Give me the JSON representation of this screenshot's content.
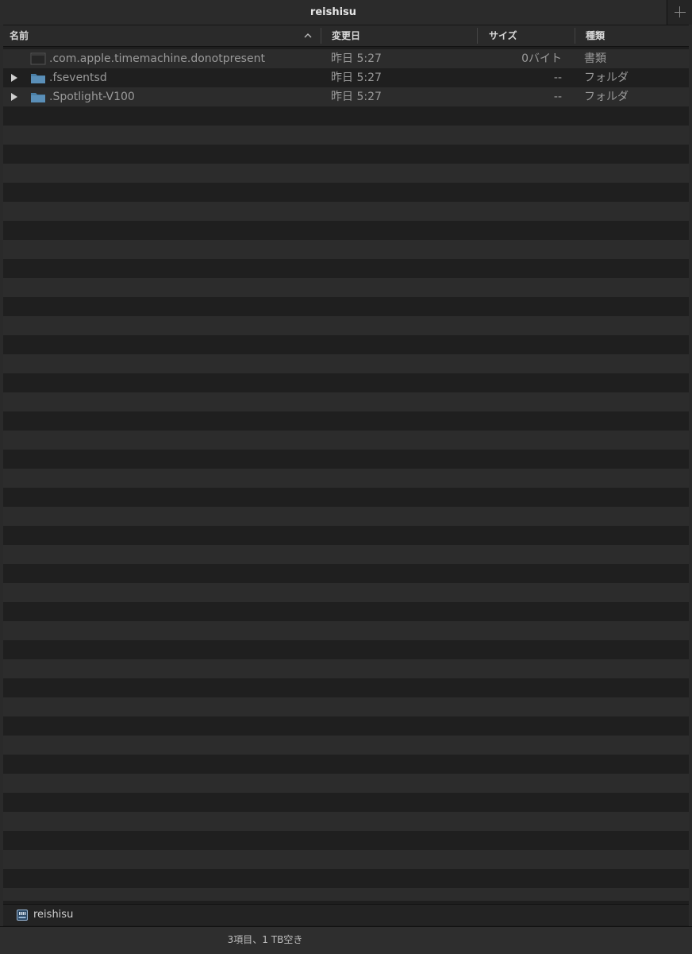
{
  "window": {
    "title": "reishisu",
    "new_tab_label": "+"
  },
  "columns": {
    "name": "名前",
    "modified": "変更日",
    "size": "サイズ",
    "kind": "種類",
    "sort_indicator": "chevron-up-icon"
  },
  "rows": [
    {
      "name": ".com.apple.timemachine.donotpresent",
      "modified": "昨日 5:27",
      "size": "0バイト",
      "kind": "書類",
      "icon": "document-icon",
      "expandable": false
    },
    {
      "name": ".fseventsd",
      "modified": "昨日 5:27",
      "size": "--",
      "kind": "フォルダ",
      "icon": "folder-icon",
      "expandable": true
    },
    {
      "name": ".Spotlight-V100",
      "modified": "昨日 5:27",
      "size": "--",
      "kind": "フォルダ",
      "icon": "folder-icon",
      "expandable": true
    }
  ],
  "path_bar": {
    "volume_name": "reishisu",
    "icon": "external-drive-icon"
  },
  "status_bar": {
    "text": "3項目、1 TB空き"
  },
  "colors": {
    "background_dark": "#1e1e1e",
    "row_stripe": "#2c2c2c",
    "folder_blue": "#4a7fa6",
    "text_dim": "#9a9a9a"
  }
}
